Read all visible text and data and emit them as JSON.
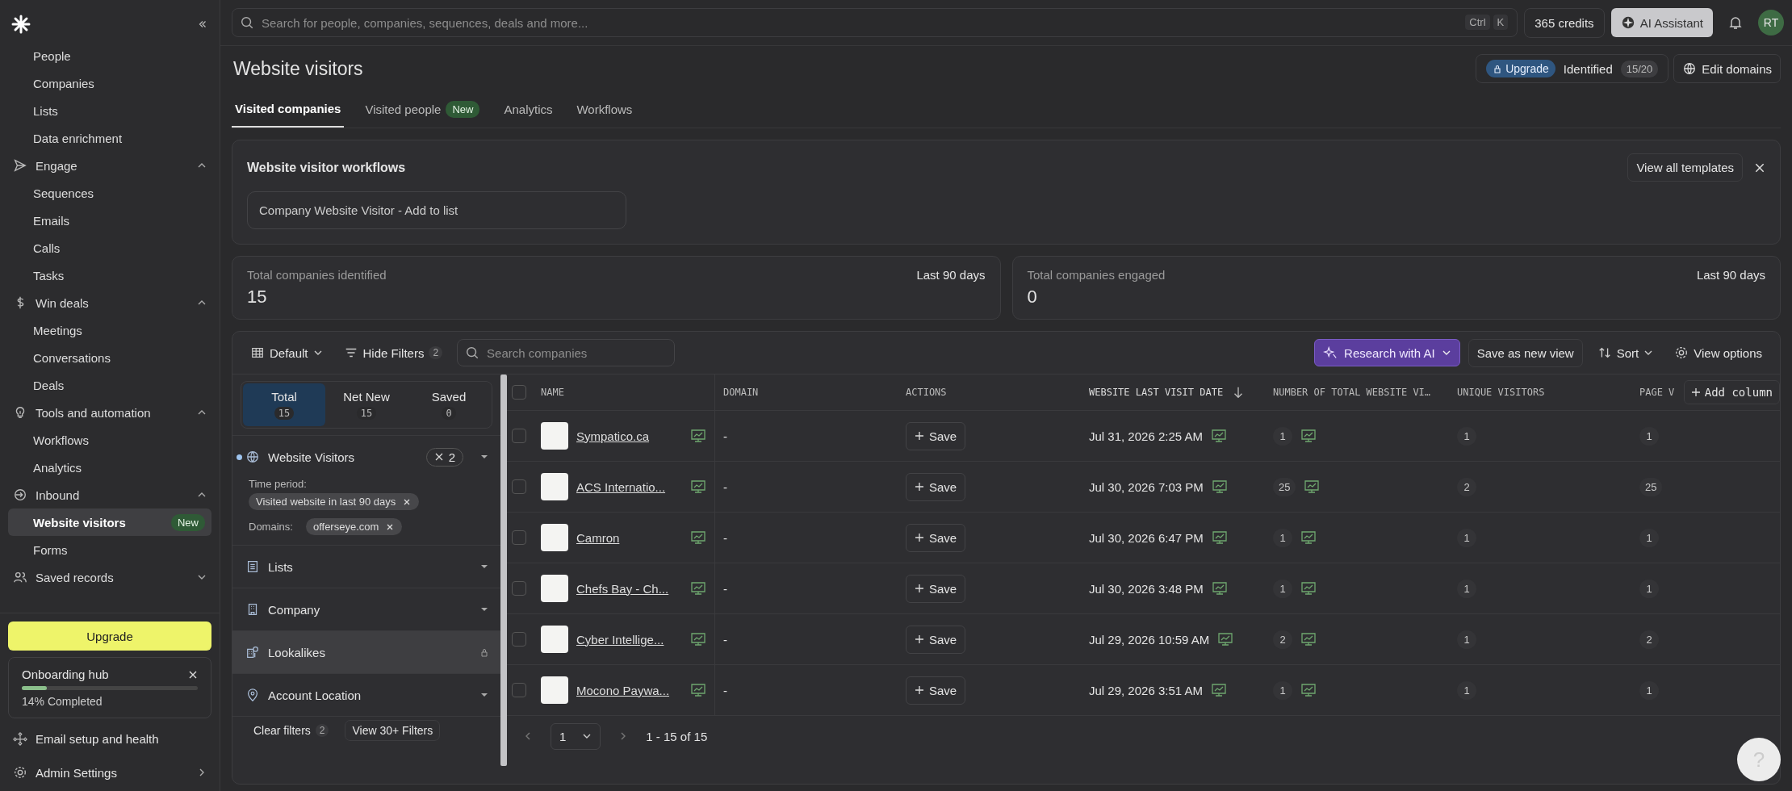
{
  "topbar": {
    "search_placeholder": "Search for people, companies, sequences, deals and more...",
    "shortcut": [
      "Ctrl",
      "K"
    ],
    "credits": "365 credits",
    "ai_button": "AI Assistant",
    "avatar": "RT"
  },
  "sidebar": {
    "groups": [
      {
        "items": [
          {
            "label": "People",
            "selected": false
          },
          {
            "label": "Companies",
            "selected": false
          },
          {
            "label": "Lists",
            "selected": false
          },
          {
            "label": "Data enrichment",
            "selected": false
          }
        ]
      },
      {
        "label": "Engage",
        "expanded": true,
        "items": [
          {
            "label": "Sequences",
            "selected": false
          },
          {
            "label": "Emails",
            "selected": false
          },
          {
            "label": "Calls",
            "selected": false
          },
          {
            "label": "Tasks",
            "selected": false
          }
        ]
      },
      {
        "label": "Win deals",
        "expanded": true,
        "items": [
          {
            "label": "Meetings",
            "selected": false
          },
          {
            "label": "Conversations",
            "selected": false
          },
          {
            "label": "Deals",
            "selected": false
          }
        ]
      },
      {
        "label": "Tools and automation",
        "expanded": true,
        "items": [
          {
            "label": "Workflows",
            "selected": false
          },
          {
            "label": "Analytics",
            "selected": false
          }
        ]
      },
      {
        "label": "Inbound",
        "expanded": true,
        "items": [
          {
            "label": "Website visitors",
            "selected": true,
            "badge": "New"
          },
          {
            "label": "Forms",
            "selected": false
          }
        ]
      },
      {
        "label": "Saved records",
        "expanded": false
      }
    ],
    "upgrade": "Upgrade",
    "onboarding": {
      "title": "Onboarding hub",
      "level": 0.14,
      "progress_text": "14% Completed"
    },
    "footer_links": [
      {
        "label": "Email setup and health"
      },
      {
        "label": "Admin Settings"
      }
    ]
  },
  "header": {
    "title": "Website visitors",
    "upgrade_badge": "Upgrade",
    "identified_label": "Identified",
    "identified_count": "15/20",
    "edit_domains": "Edit domains"
  },
  "tabs": [
    {
      "label": "Visited companies",
      "selected": true
    },
    {
      "label": "Visited people",
      "selected": false,
      "badge": "New"
    },
    {
      "label": "Analytics",
      "selected": false
    },
    {
      "label": "Workflows",
      "selected": false
    }
  ],
  "workflows": {
    "title": "Website visitor workflows",
    "template": "Company Website Visitor - Add to list",
    "view_all": "View all templates"
  },
  "stats": [
    {
      "label": "Total companies identified",
      "period": "Last 90 days",
      "value": "15"
    },
    {
      "label": "Total companies engaged",
      "period": "Last 90 days",
      "value": "0"
    }
  ],
  "toolbar": {
    "view": "Default",
    "hide_filters": "Hide Filters",
    "filter_count": "2",
    "search_placeholder": "Search companies",
    "research": "Research with AI",
    "save_view": "Save as new view",
    "sort": "Sort",
    "view_options": "View options"
  },
  "filters": {
    "segments": [
      {
        "label": "Total",
        "count": "15",
        "selected": true
      },
      {
        "label": "Net New",
        "count": "15",
        "selected": false
      },
      {
        "label": "Saved",
        "count": "0",
        "selected": false
      }
    ],
    "items": [
      {
        "label": "Website Visitors",
        "active": true,
        "locked": false,
        "count": "2",
        "details": [
          {
            "label": "Time period:",
            "chip": "Visited website in last 90 days"
          },
          {
            "label": "Domains:",
            "chip": "offerseye.com"
          }
        ]
      },
      {
        "label": "Lists",
        "active": false,
        "locked": false
      },
      {
        "label": "Company",
        "active": false,
        "locked": false
      },
      {
        "label": "Lookalikes",
        "active": false,
        "locked": true
      },
      {
        "label": "Account Location",
        "active": false,
        "locked": false
      }
    ],
    "clear": "Clear filters",
    "clear_count": "2",
    "view_more": "View 30+ Filters"
  },
  "table": {
    "columns": [
      {
        "label": "NAME",
        "sorted": false
      },
      {
        "label": "DOMAIN",
        "sorted": false
      },
      {
        "label": "ACTIONS",
        "sorted": false
      },
      {
        "label": "WEBSITE LAST VISIT DATE",
        "sorted": true
      },
      {
        "label": "NUMBER OF TOTAL WEBSITE VI…",
        "sorted": false
      },
      {
        "label": "UNIQUE VISITORS",
        "sorted": false
      },
      {
        "label": "PAGE V",
        "sorted": false
      }
    ],
    "select_all_checked": false,
    "add_column": "Add column",
    "rows": [
      {
        "checked": false,
        "name": "Sympatico.ca",
        "domain": "-",
        "action": "Save",
        "date": "Jul 31, 2026 2:25 AM",
        "total": "1",
        "unique": "1",
        "pages": "1"
      },
      {
        "checked": false,
        "name": "ACS Internatio...",
        "domain": "-",
        "action": "Save",
        "date": "Jul 30, 2026 7:03 PM",
        "total": "25",
        "unique": "2",
        "pages": "25"
      },
      {
        "checked": false,
        "name": "Camron",
        "domain": "-",
        "action": "Save",
        "date": "Jul 30, 2026 6:47 PM",
        "total": "1",
        "unique": "1",
        "pages": "1"
      },
      {
        "checked": false,
        "name": "Chefs Bay - Ch...",
        "domain": "-",
        "action": "Save",
        "date": "Jul 30, 2026 3:48 PM",
        "total": "1",
        "unique": "1",
        "pages": "1"
      },
      {
        "checked": false,
        "name": "Cyber Intellige...",
        "domain": "-",
        "action": "Save",
        "date": "Jul 29, 2026 10:59 AM",
        "total": "2",
        "unique": "1",
        "pages": "2"
      },
      {
        "checked": false,
        "name": "Mocono Paywa...",
        "domain": "-",
        "action": "Save",
        "date": "Jul 29, 2026 3:51 AM",
        "total": "1",
        "unique": "1",
        "pages": "1"
      }
    ]
  },
  "pagination": {
    "page": "1",
    "range": "1 - 15 of 15"
  },
  "help": "?"
}
